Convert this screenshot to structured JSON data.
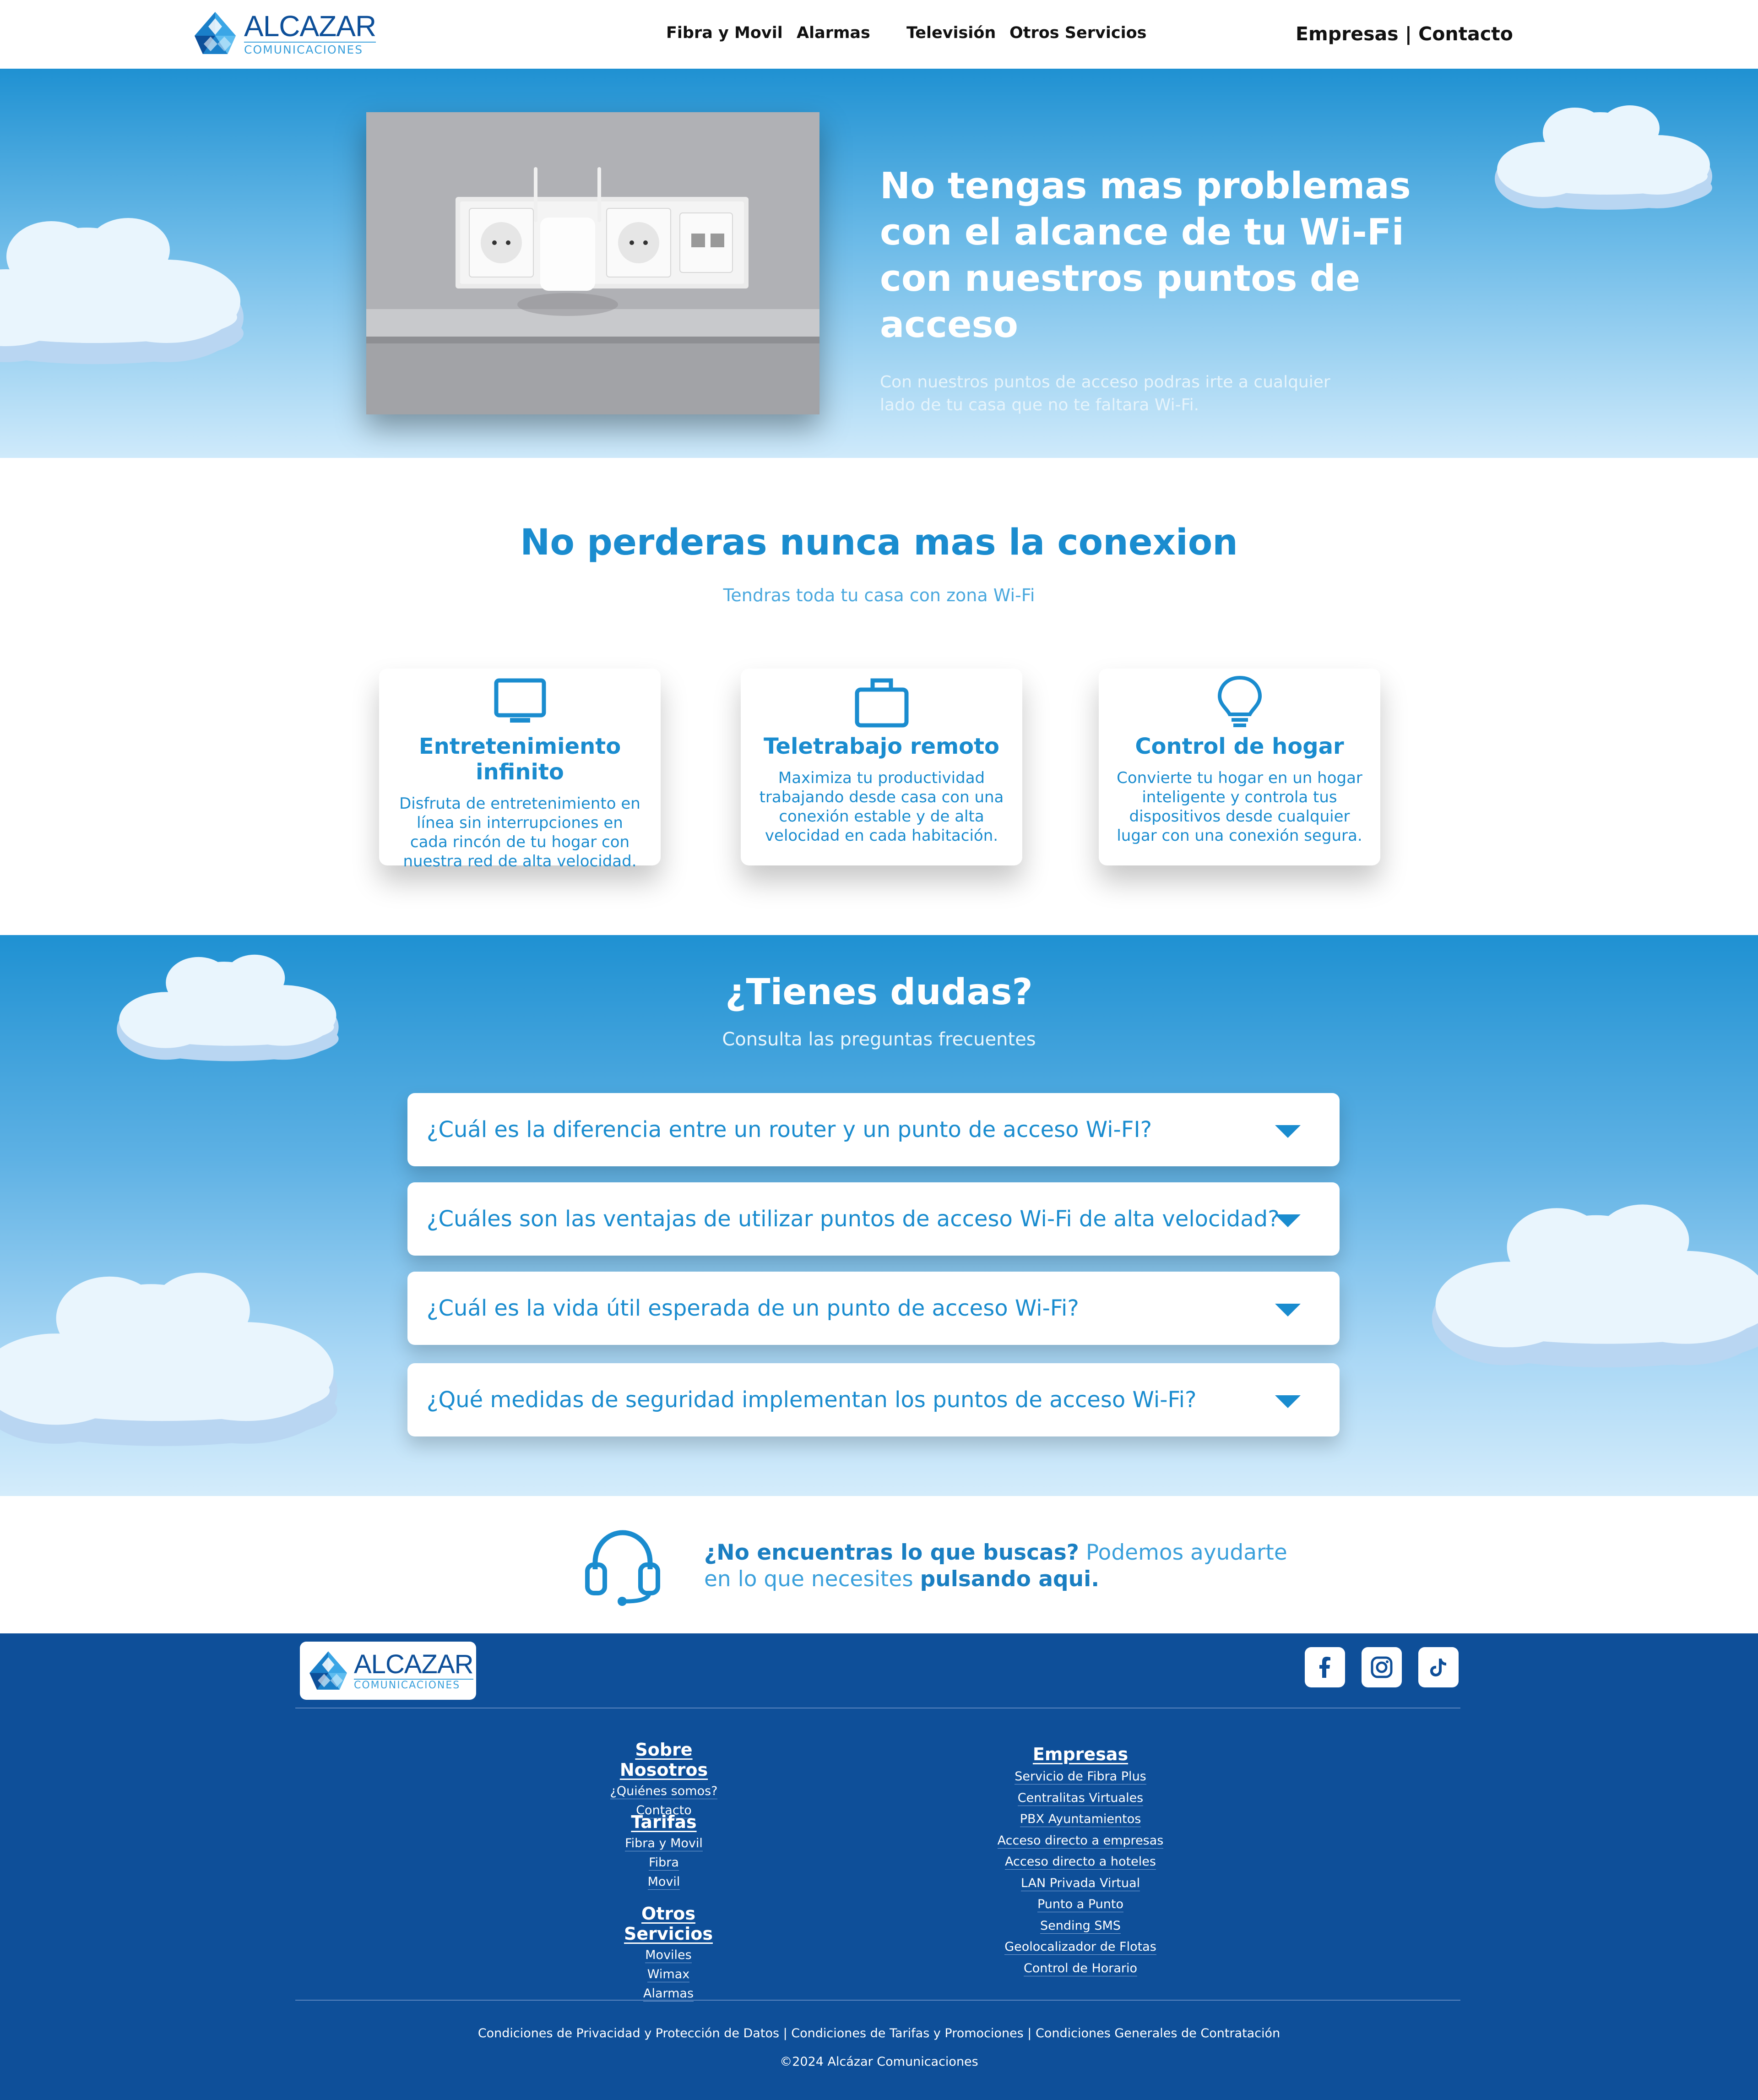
{
  "header": {
    "logo_brand": "ALCAZAR",
    "logo_sub": "COMUNICACIONES",
    "nav": [
      "Fibra y Movil",
      "Alarmas",
      "Televisión",
      "Otros Servicios"
    ],
    "right_links": [
      "Empresas",
      "Contacto"
    ],
    "separator": "|"
  },
  "hero": {
    "title": "No tengas mas problemas con el alcance de tu Wi-Fi con nuestros puntos de acceso",
    "subtitle": "Con nuestros puntos de acceso podras irte a cualquier lado de tu casa que no te faltara Wi-Fi."
  },
  "features": {
    "title": "No perderas nunca mas la conexion",
    "subtitle": "Tendras toda tu casa con zona Wi-Fi",
    "cards": [
      {
        "icon": "monitor-icon",
        "title": "Entretenimiento infinito",
        "text": "Disfruta de entretenimiento en línea sin interrupciones en cada rincón de tu hogar con nuestra red de alta velocidad."
      },
      {
        "icon": "briefcase-icon",
        "title": "Teletrabajo remoto",
        "text": "Maximiza tu productividad trabajando desde casa con una conexión estable y de alta velocidad en cada habitación."
      },
      {
        "icon": "lightbulb-icon",
        "title": "Control de hogar",
        "text": "Convierte tu hogar en un hogar inteligente y controla tus dispositivos desde cualquier lugar con una conexión segura."
      }
    ]
  },
  "faq": {
    "title": "¿Tienes dudas?",
    "subtitle": "Consulta las preguntas frecuentes",
    "items": [
      "¿Cuál es la diferencia entre un router y un punto de acceso Wi-FI?",
      "¿Cuáles son las ventajas de utilizar puntos de acceso Wi-Fi de alta velocidad?",
      "¿Cuál es la vida útil esperada de un punto de acceso Wi-Fi?",
      "¿Qué medidas de seguridad implementan los puntos de acceso Wi-Fi?"
    ]
  },
  "help": {
    "bold1": "¿No encuentras lo que buscas?",
    "text": " Podemos ayudarte en lo que necesites ",
    "bold2": "pulsando aqui."
  },
  "footer": {
    "logo_brand": "ALCAZAR",
    "logo_sub": "COMUNICACIONES",
    "social": [
      "facebook-icon",
      "instagram-icon",
      "tiktok-icon"
    ],
    "col1": [
      {
        "heading": "Sobre Nosotros",
        "links": [
          "¿Quiénes somos?",
          "Contacto"
        ]
      },
      {
        "heading": "Tarifas",
        "links": [
          "Fibra y Movil",
          "Fibra",
          "Movil"
        ]
      },
      {
        "heading": "Otros Servicios",
        "links": [
          "Moviles",
          "Wimax",
          "Alarmas"
        ]
      }
    ],
    "col2": {
      "heading": "Empresas",
      "links": [
        "Servicio de Fibra Plus",
        "Centralitas Virtuales",
        "PBX Ayuntamientos",
        "Acceso directo a empresas",
        "Acceso directo a hoteles",
        "LAN Privada Virtual",
        "Punto a Punto",
        "Sending SMS",
        "Geolocalizador de Flotas",
        "Control de Horario"
      ]
    },
    "legal": "Condiciones de Privacidad y Protección de Datos | Condiciones de Tarifas y Promociones | Condiciones Generales de Contratación",
    "copyright": "©2024 Alcázar Comunicaciones"
  },
  "colors": {
    "brand_blue": "#1a8ccf",
    "footer_blue": "#0e4f99",
    "sky_top": "#1f91d2",
    "sky_bottom": "#d4ecfb"
  }
}
